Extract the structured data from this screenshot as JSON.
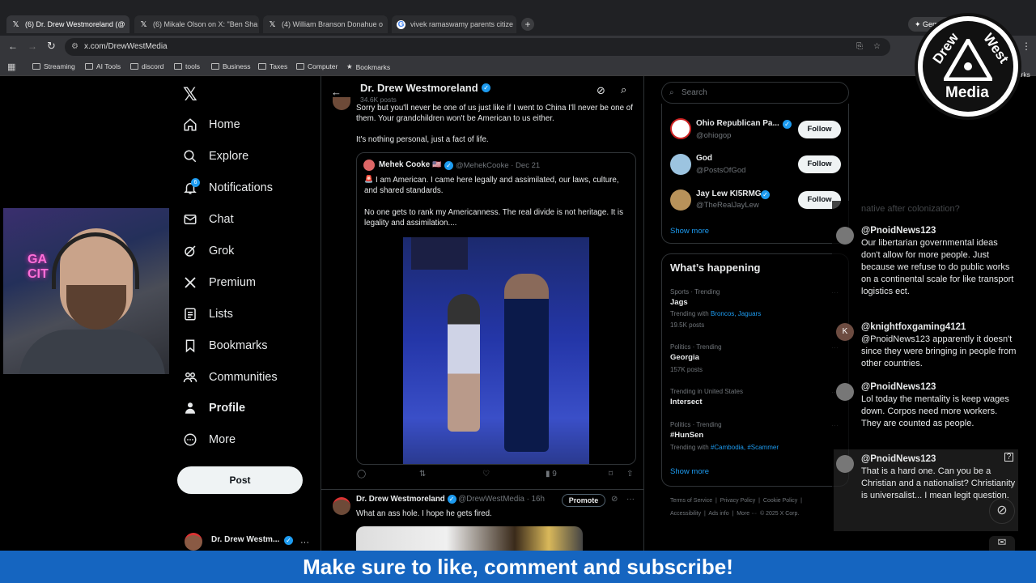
{
  "browser": {
    "tabs": [
      {
        "title": "(6) Dr. Drew Westmoreland (@",
        "active": true
      },
      {
        "title": "(6) Mikale Olson on X: \"Ben Sha",
        "active": false
      },
      {
        "title": "(4) William Branson Donahue o",
        "active": false
      },
      {
        "title": "vivek ramaswamy parents citize",
        "active": false
      }
    ],
    "url": "x.com/DrewWestMedia",
    "extension_label": "Gemini",
    "bookmarks": [
      "Streaming",
      "AI Tools",
      "discord",
      "tools",
      "Business",
      "Taxes",
      "Computer",
      "Bookmarks"
    ],
    "all_bookmarks": "All Bookmarks"
  },
  "nav": {
    "items": [
      {
        "label": "Home",
        "icon": "home-icon"
      },
      {
        "label": "Explore",
        "icon": "search-icon"
      },
      {
        "label": "Notifications",
        "icon": "bell-icon",
        "badge": "6"
      },
      {
        "label": "Chat",
        "icon": "mail-icon"
      },
      {
        "label": "Grok",
        "icon": "grok-icon"
      },
      {
        "label": "Premium",
        "icon": "x-logo-icon"
      },
      {
        "label": "Lists",
        "icon": "list-icon"
      },
      {
        "label": "Bookmarks",
        "icon": "bookmark-icon"
      },
      {
        "label": "Communities",
        "icon": "people-icon"
      },
      {
        "label": "Profile",
        "icon": "person-icon"
      },
      {
        "label": "More",
        "icon": "more-circle-icon"
      }
    ],
    "post_label": "Post",
    "account_name": "Dr. Drew Westm..."
  },
  "header": {
    "name": "Dr. Drew Westmoreland",
    "posts": "34.6K posts"
  },
  "tweet1": {
    "text_top": "Sorry but you'll never be one of us just like if I went to China I'll never be one of them. Your grandchildren won't be American to us either.",
    "text_bottom": "It's nothing personal, just a fact of life.",
    "quote": {
      "name": "Mehek Cooke",
      "handle": "@MehekCooke · Dec 21",
      "text1": "I am American. I came here legally and assimilated, our laws, culture, and shared standards.",
      "text2": "No one gets to rank my Americanness. The real divide is not heritage. It is legality and assimilation...."
    },
    "views": "9"
  },
  "tweet2": {
    "name": "Dr. Drew Westmoreland",
    "handle": "@DrewWestMedia · 16h",
    "promote": "Promote",
    "text": "What an ass hole. I hope he gets fired."
  },
  "sidebar": {
    "search_placeholder": "Search",
    "who_to_follow": [
      {
        "name": "Ohio Republican Pa...",
        "handle": "@ohiogop",
        "avatar_color": "#ffffff"
      },
      {
        "name": "God",
        "handle": "@PostsOfGod",
        "avatar_color": "#9cc4e0"
      },
      {
        "name": "Jay Lew KI5RMG",
        "handle": "@TheRealJayLew",
        "avatar_color": "#b8925a"
      }
    ],
    "follow_label": "Follow",
    "show_more": "Show more",
    "whats_happening": "What’s happening",
    "trends": [
      {
        "meta": "Sports · Trending",
        "title": "Jags",
        "extra_prefix": "Trending with ",
        "extra_links": "Broncos, Jaguars",
        "count": "19.5K posts"
      },
      {
        "meta": "Politics · Trending",
        "title": "Georgia",
        "extra_prefix": "",
        "extra_links": "",
        "count": "157K posts"
      },
      {
        "meta": "Trending in United States",
        "title": "Intersect",
        "extra_prefix": "",
        "extra_links": "",
        "count": ""
      },
      {
        "meta": "Politics · Trending",
        "title": "#HunSen",
        "extra_prefix": "Trending with ",
        "extra_links": "#Cambodia, #Scammer",
        "count": ""
      }
    ],
    "footer1": "Terms of Service  |  Privacy Policy  |  Cookie Policy  |",
    "footer2": "Accessibility  |  Ads info  |  More ···  © 2025 X Corp."
  },
  "overlay": {
    "logo_lines": [
      "Drew",
      "West",
      "Media"
    ],
    "chat_faded": "native after colonization?",
    "chat": [
      {
        "author": "@PnoidNews123",
        "avatar": "",
        "text": "Our libertarian governmental ideas don't allow for more people. Just because we refuse to do public works on a continental scale for like transport logistics ect."
      },
      {
        "author": "@knightfoxgaming4121",
        "avatar": "K",
        "text": "@PnoidNews123 apparently it doesn't since they were bringing in people from other countries."
      },
      {
        "author": "@PnoidNews123",
        "avatar": "",
        "text": "Lol today the mentality is keep wages down. Corpos need more workers. They are counted as people."
      },
      {
        "author": "@PnoidNews123",
        "avatar": "",
        "text": "That is a hard one. Can you be a Christian and a nationalist? Christianity is universalist... I mean legit question."
      }
    ],
    "banner": "Make sure to like, comment and subscribe!"
  }
}
